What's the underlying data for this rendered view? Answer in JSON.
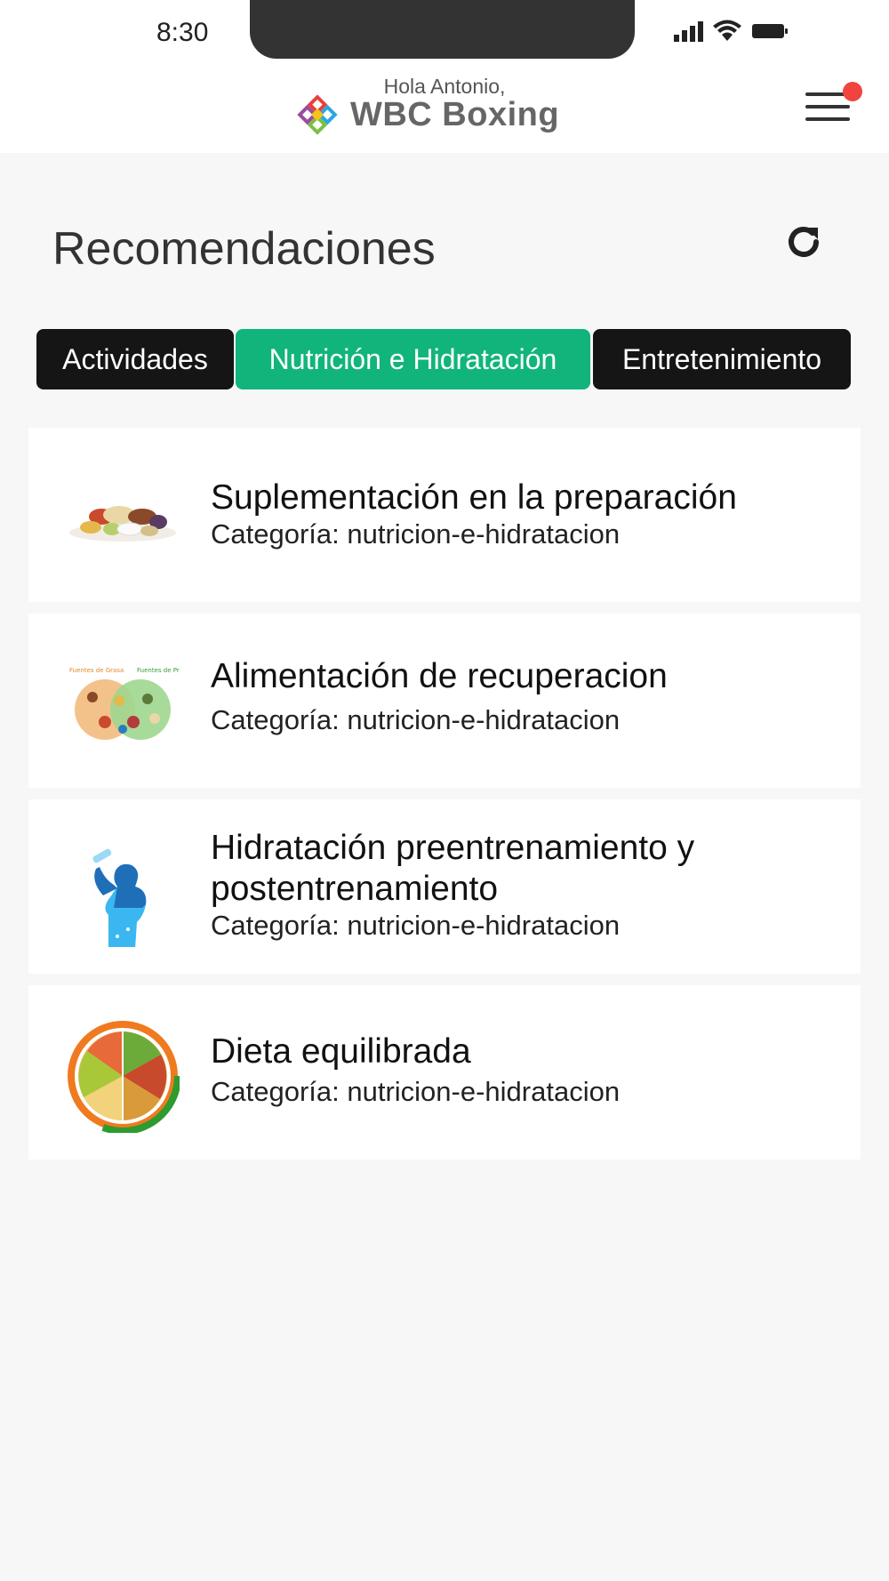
{
  "status_bar": {
    "time": "8:30"
  },
  "header": {
    "greeting": "Hola Antonio,",
    "brand": "WBC Boxing",
    "menu_icon": "hamburger-menu-icon",
    "notification_color": "#f2443f"
  },
  "page": {
    "title": "Recomendaciones",
    "refresh_icon": "refresh-icon"
  },
  "tabs": [
    {
      "label": "Actividades",
      "active": false
    },
    {
      "label": "Nutrición e Hidratación",
      "active": true
    },
    {
      "label": "Entretenimiento",
      "active": false
    }
  ],
  "accent_color": "#11b57b",
  "items": [
    {
      "title": "Suplementación en la preparación",
      "category": "Categoría: nutricion-e-hidratacion",
      "image": "supplements-pills-image"
    },
    {
      "title": "Alimentación de recuperacion",
      "category": "Categoría: nutricion-e-hidratacion",
      "image": "food-groups-image",
      "image_labels": [
        "Fuentes de Grasa",
        "Fuentes de Proteína"
      ]
    },
    {
      "title_line1": "Hidratación preentrenamiento y",
      "title_line2": "postentrenamiento",
      "category": "Categoría: nutricion-e-hidratacion",
      "image": "person-drinking-water-image"
    },
    {
      "title": "Dieta equilibrada",
      "category": "Categoría: nutricion-e-hidratacion",
      "image": "balanced-diet-plate-image"
    }
  ]
}
